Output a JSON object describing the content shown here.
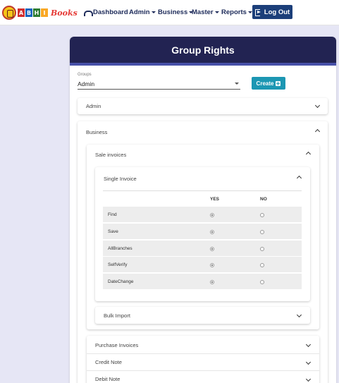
{
  "navbar": {
    "logo_letters": [
      "A",
      "B",
      "H",
      "I"
    ],
    "logo_books": "Books",
    "dashboard": "Dashboard",
    "admin": "Admin",
    "business": "Business",
    "master": "Master",
    "reports": "Reports",
    "logout": "Log Out"
  },
  "page": {
    "title": "Group Rights"
  },
  "groups_select": {
    "label": "Groups",
    "value": "Admin"
  },
  "create_button": "Create",
  "sections": {
    "admin": "Admin",
    "business": "Business",
    "sale_invoices": "Sale invoices",
    "single_invoice": "Single Invoice",
    "bulk_import": "Bulk Import",
    "purchase_invoices": "Purchase Invoices",
    "credit_note": "Credit Note",
    "debit_note": "Debit Note"
  },
  "rights_table": {
    "headers": {
      "yes": "YES",
      "no": "NO"
    },
    "rows": [
      {
        "label": "Find",
        "value": "yes"
      },
      {
        "label": "Save",
        "value": "yes"
      },
      {
        "label": "AllBranches",
        "value": "yes"
      },
      {
        "label": "SelfVerify",
        "value": "yes"
      },
      {
        "label": "DateChange",
        "value": "yes"
      }
    ]
  },
  "colors": {
    "header_bg": "#222352",
    "header_strip": "#4750a8",
    "create_btn": "#1c97b3",
    "logout_btn": "#1c3f7a",
    "page_bg": "#e6e6f5"
  }
}
